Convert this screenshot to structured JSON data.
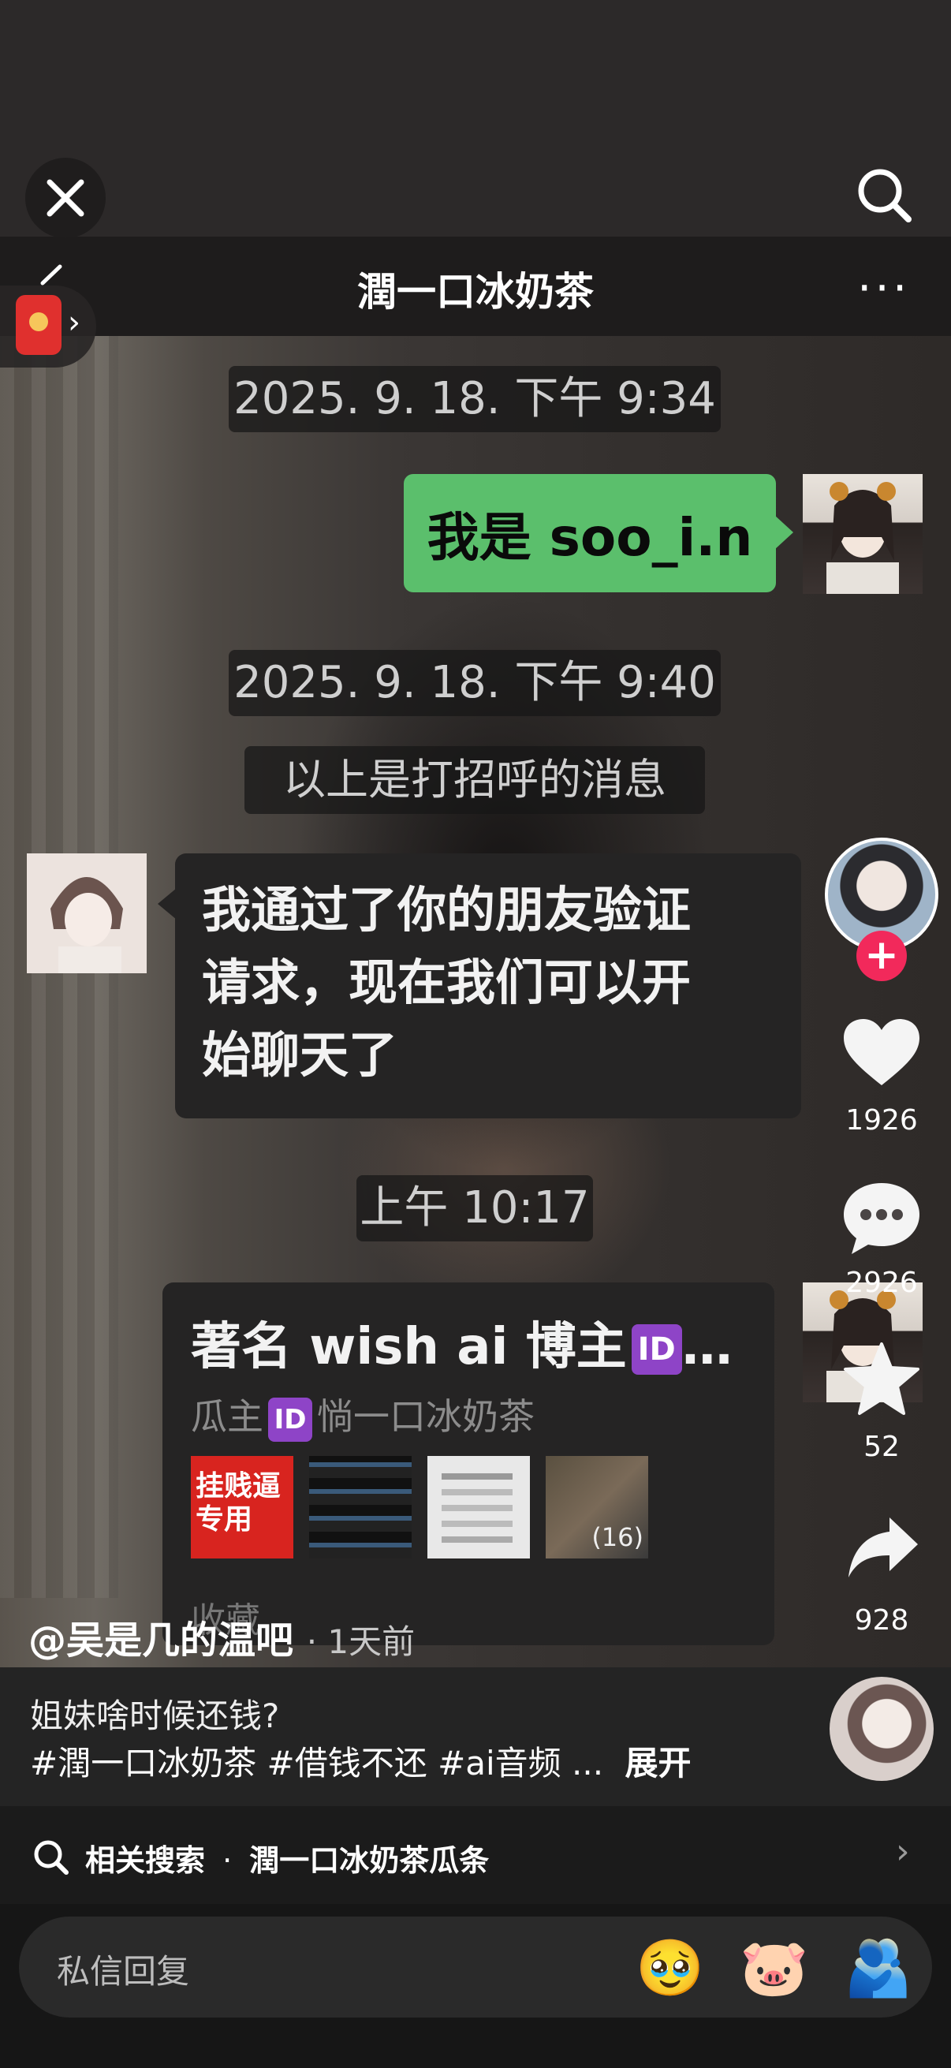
{
  "chat": {
    "title": "潤一口冰奶茶",
    "more_label": "···",
    "timestamps": [
      "2025. 9. 18. 下午 9:34",
      "2025. 9. 18. 下午 9:40",
      "上午 10:17"
    ],
    "system_note": "以上是打招呼的消息",
    "sent_message": "我是 soo_i.n",
    "received_lines": [
      "我通过了你的朋友验证",
      "请求，现在我们可以开",
      "始聊天了"
    ],
    "card": {
      "title_text": "著名 wish ai 博主",
      "title_badge": "ID",
      "title_suffix": "…",
      "sub_prefix": "瓜主",
      "sub_badge": "ID",
      "sub_name": "惝一口冰奶茶",
      "thumb1_line1": "挂贱逼",
      "thumb1_line2": "专用",
      "thumb_count": "(16)",
      "bottom_label": "收藏"
    }
  },
  "actions": {
    "likes": "1926",
    "comments": "2926",
    "favorites": "52",
    "shares": "928"
  },
  "post": {
    "author": "@吴是几的温吧",
    "time_ago": "· 1天前",
    "caption": "姐妹啥时候还钱?",
    "hashtags": "#潤一口冰奶茶 #借钱不还  #ai音频 ...",
    "expand_label": "展开"
  },
  "related_search": {
    "label": "相关搜索",
    "dot": "·",
    "query": "潤一口冰奶茶瓜条"
  },
  "reply": {
    "placeholder": "私信回复",
    "emojis": [
      "🥹",
      "🐷",
      "🫂"
    ]
  },
  "icons": {
    "close": "close-icon",
    "search": "search-icon",
    "heart": "heart-icon",
    "comment": "comment-icon",
    "star": "star-icon",
    "share": "share-icon"
  },
  "colors": {
    "sent_bubble": "#5bbf6c",
    "follow_plus": "#f2295b",
    "id_badge": "#8e44c7"
  }
}
